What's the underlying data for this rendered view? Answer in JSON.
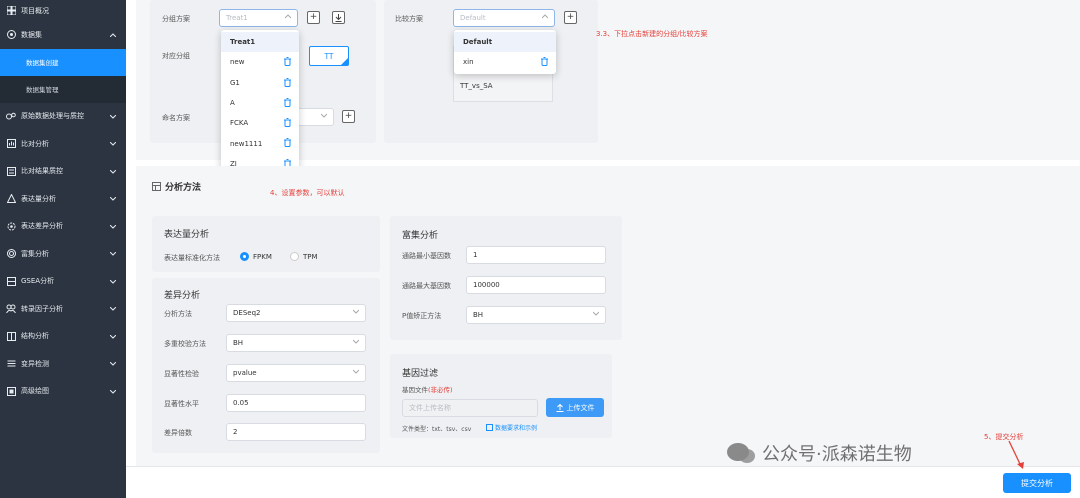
{
  "sidebar": {
    "items": [
      {
        "label": "项目概况",
        "icon": "grid-icon",
        "chevron": ""
      },
      {
        "label": "数据集",
        "icon": "disc-icon",
        "chevron": "up"
      },
      {
        "label": "原始数据处理与质控",
        "icon": "flask-icon",
        "chevron": "down"
      },
      {
        "label": "比对分析",
        "icon": "chart-icon",
        "chevron": "down"
      },
      {
        "label": "比对结果质控",
        "icon": "list-icon",
        "chevron": "down"
      },
      {
        "label": "表达量分析",
        "icon": "triangle-icon",
        "chevron": "down"
      },
      {
        "label": "表达差异分析",
        "icon": "gear-icon",
        "chevron": "down"
      },
      {
        "label": "富集分析",
        "icon": "target-icon",
        "chevron": "down"
      },
      {
        "label": "GSEA分析",
        "icon": "bars-icon",
        "chevron": "down"
      },
      {
        "label": "转录因子分析",
        "icon": "people-icon",
        "chevron": "down"
      },
      {
        "label": "结构分析",
        "icon": "book-icon",
        "chevron": "down"
      },
      {
        "label": "变异检测",
        "icon": "diff-icon",
        "chevron": "down"
      },
      {
        "label": "高级绘图",
        "icon": "palette-icon",
        "chevron": "down"
      }
    ],
    "subitems": [
      {
        "label": "数据集创建",
        "active": true
      },
      {
        "label": "数据集管理",
        "active": false
      }
    ]
  },
  "top": {
    "group_label": "分组方案",
    "group_value": "Treat1",
    "compare_label": "比较方案",
    "compare_value": "Default",
    "corr_label": "对应分组",
    "tt_tag": "TT",
    "name_label": "命名方案",
    "group_options": [
      "Treat1",
      "new",
      "G1",
      "A",
      "FCKA",
      "new1111",
      "ZJ"
    ],
    "compare_options": [
      "Default",
      "xin"
    ],
    "compare_list": [
      "TT_vs_SA"
    ],
    "annot_33": "3.3、下拉点击新建的分组/比较方案"
  },
  "method": {
    "title": "分析方法",
    "annot_4": "4、设置参数，可以默认",
    "expr": {
      "title": "表达量分析",
      "norm_label": "表达量标准化方法",
      "opt1": "FPKM",
      "opt2": "TPM"
    },
    "diff": {
      "title": "差异分析",
      "method_label": "分析方法",
      "method_value": "DESeq2",
      "multi_label": "多重校验方法",
      "multi_value": "BH",
      "sig_label": "显著性检验",
      "sig_value": "pvalue",
      "level_label": "显著性水平",
      "level_value": "0.05",
      "fold_label": "差异倍数",
      "fold_value": "2"
    },
    "enrich": {
      "title": "富集分析",
      "min_label": "通路最小基因数",
      "min_value": "1",
      "max_label": "通路最大基因数",
      "max_value": "100000",
      "padj_label": "P值矫正方法",
      "padj_value": "BH"
    },
    "filter": {
      "title": "基因过滤",
      "file_label": "基因文件",
      "file_note": "(非必传)",
      "file_placeholder": "文件上传名称",
      "upload_label": "上传文件",
      "types": "文件类型：txt、tsv、csv",
      "example_link": "数据要求和示例"
    }
  },
  "submit": {
    "annot_5": "5、提交分析",
    "button": "提交分析"
  },
  "watermark": "公众号·派森诺生物",
  "colors": {
    "accent": "#1890ff",
    "annotation": "#e5403a",
    "sidebar": "#2b3440"
  }
}
